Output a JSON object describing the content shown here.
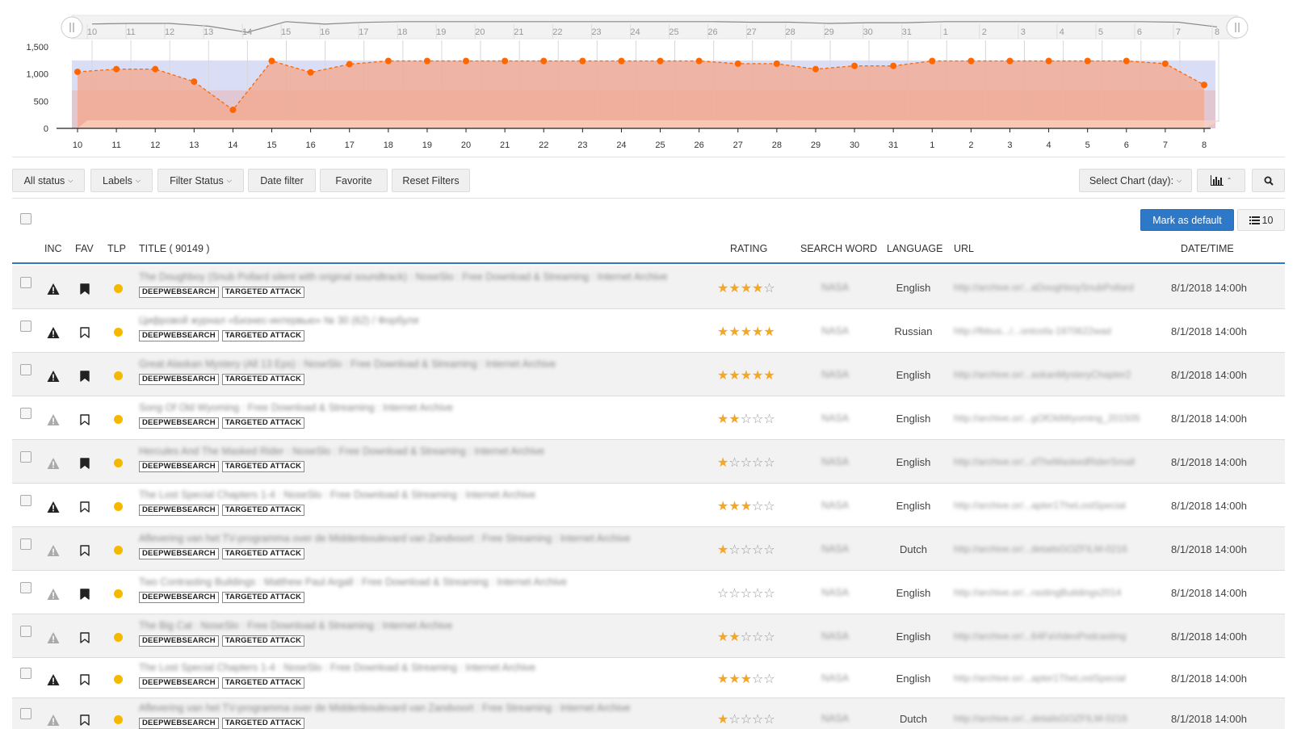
{
  "chart": {
    "navigator_labels": [
      "10",
      "11",
      "12",
      "13",
      "14",
      "15",
      "16",
      "17",
      "18",
      "19",
      "20",
      "21",
      "22",
      "23",
      "24",
      "25",
      "26",
      "27",
      "28",
      "29",
      "30",
      "31",
      "1",
      "2",
      "3",
      "4",
      "5",
      "6",
      "7",
      "8"
    ],
    "x_labels": [
      "10",
      "11",
      "12",
      "13",
      "14",
      "15",
      "16",
      "17",
      "18",
      "19",
      "20",
      "21",
      "22",
      "23",
      "24",
      "25",
      "26",
      "27",
      "28",
      "29",
      "30",
      "31",
      "1",
      "2",
      "3",
      "4",
      "5",
      "6",
      "7",
      "8"
    ],
    "y_ticks": [
      "1,500",
      "1,000",
      "500",
      "0"
    ],
    "series_color": "#ff6600",
    "fill_color": "#f4a58a",
    "band_color": "#d3d7f5"
  },
  "chart_data": {
    "type": "area",
    "x": [
      "10",
      "11",
      "12",
      "13",
      "14",
      "15",
      "16",
      "17",
      "18",
      "19",
      "20",
      "21",
      "22",
      "23",
      "24",
      "25",
      "26",
      "27",
      "28",
      "29",
      "30",
      "31",
      "1",
      "2",
      "3",
      "4",
      "5",
      "6",
      "7",
      "8"
    ],
    "series": [
      {
        "values": [
          1040,
          1090,
          1090,
          860,
          340,
          1240,
          1030,
          1180,
          1240,
          1240,
          1240,
          1240,
          1240,
          1240,
          1240,
          1240,
          1240,
          1190,
          1190,
          1090,
          1150,
          1150,
          1240,
          1240,
          1240,
          1240,
          1240,
          1240,
          1190,
          800
        ]
      }
    ],
    "ylim": [
      0,
      1500
    ],
    "y_ticks": [
      0,
      500,
      1000,
      1500
    ],
    "grid": true,
    "legend": "none"
  },
  "toolbar": {
    "all_status": "All status",
    "labels": "Labels",
    "filter_status": "Filter Status",
    "date_filter": "Date filter",
    "favorite": "Favorite",
    "reset_filters": "Reset Filters",
    "select_chart": "Select Chart (day):"
  },
  "actions": {
    "mark_default": "Mark as default",
    "page_size": "10"
  },
  "table": {
    "headers": {
      "inc": "INC",
      "fav": "FAV",
      "tlp": "TLP",
      "title": "TITLE ( 90149 )",
      "rating": "RATING",
      "search_word": "SEARCH WORD",
      "language": "LANGUAGE",
      "url": "URL",
      "datetime": "DATE/TIME"
    },
    "rows": [
      {
        "title": "The Doughboy (Snub Pollard silent with original soundtrack) : NoseSlo : Free Download & Streaming : Internet Archive",
        "tags": [
          "DEEPWEBSEARCH",
          "TARGETED ATTACK"
        ],
        "inc": "critical",
        "fav": true,
        "rating": 4,
        "search_word": "NASA",
        "language": "English",
        "url": "http://archive.or/...aDoughboySnubPollard",
        "datetime": "8/1/2018 14:00h"
      },
      {
        "title": "Цифровой журнал «Бизнес-интервью» № 30 (62) / Форбуля",
        "tags": [
          "DEEPWEBSEARCH",
          "TARGETED ATTACK"
        ],
        "inc": "critical",
        "fav": false,
        "rating": 5,
        "search_word": "NASA",
        "language": "Russian",
        "url": "http://fbbus.../...ontosfa-1970622wad",
        "datetime": "8/1/2018 14:00h"
      },
      {
        "title": "Great Alaskan Mystery (All 13 Eps) : NoseSlo : Free Download & Streaming : Internet Archive",
        "tags": [
          "DEEPWEBSEARCH",
          "TARGETED ATTACK"
        ],
        "inc": "critical",
        "fav": true,
        "rating": 5,
        "search_word": "NASA",
        "language": "English",
        "url": "http://archive.or/...askanMysteryChapter2",
        "datetime": "8/1/2018 14:00h"
      },
      {
        "title": "Song Of Old Wyoming : Free Download & Streaming : Internet Archive",
        "tags": [
          "DEEPWEBSEARCH",
          "TARGETED ATTACK"
        ],
        "inc": "low",
        "fav": false,
        "rating": 2,
        "search_word": "NASA",
        "language": "English",
        "url": "http://archive.or/...gOfOldWyoming_201505",
        "datetime": "8/1/2018 14:00h"
      },
      {
        "title": "Hercules And The Masked Rider : NoseSlo : Free Download & Streaming : Internet Archive",
        "tags": [
          "DEEPWEBSEARCH",
          "TARGETED ATTACK"
        ],
        "inc": "low",
        "fav": true,
        "rating": 1,
        "search_word": "NASA",
        "language": "English",
        "url": "http://archive.or/...dTheMaskedRiderSmall",
        "datetime": "8/1/2018 14:00h"
      },
      {
        "title": "The Lost Special Chapters 1-4 : NoseSlo : Free Download & Streaming : Internet Archive",
        "tags": [
          "DEEPWEBSEARCH",
          "TARGETED ATTACK"
        ],
        "inc": "critical",
        "fav": false,
        "rating": 3,
        "search_word": "NASA",
        "language": "English",
        "url": "http://archive.or/...apter1TheLostSpecial",
        "datetime": "8/1/2018 14:00h"
      },
      {
        "title": "Aflevering van het TV-programma over de Middenboulevard van Zandvoort : Free Streaming : Internet Archive",
        "tags": [
          "DEEPWEBSEARCH",
          "TARGETED ATTACK"
        ],
        "inc": "low",
        "fav": false,
        "rating": 1,
        "search_word": "NASA",
        "language": "Dutch",
        "url": "http://archive.or/...detailsGOZFILM-0216",
        "datetime": "8/1/2018 14:00h"
      },
      {
        "title": "Two Contrasting Buildings : Matthew Paul Argall : Free Download & Streaming : Internet Archive",
        "tags": [
          "DEEPWEBSEARCH",
          "TARGETED ATTACK"
        ],
        "inc": "low",
        "fav": true,
        "rating": 0,
        "search_word": "NASA",
        "language": "English",
        "url": "http://archive.or/...rastingBuildings2014",
        "datetime": "8/1/2018 14:00h"
      },
      {
        "title": "The Big Cat : NoseSlo : Free Download & Streaming : Internet Archive",
        "tags": [
          "DEEPWEBSEARCH",
          "TARGETED ATTACK"
        ],
        "inc": "low",
        "fav": false,
        "rating": 2,
        "search_word": "NASA",
        "language": "English",
        "url": "http://archive.or/...64FaVideoPodcasting",
        "datetime": "8/1/2018 14:00h"
      },
      {
        "title": "The Lost Special Chapters 1-4 : NoseSlo : Free Download & Streaming : Internet Archive",
        "tags": [
          "DEEPWEBSEARCH",
          "TARGETED ATTACK"
        ],
        "inc": "critical",
        "fav": false,
        "rating": 3,
        "search_word": "NASA",
        "language": "English",
        "url": "http://archive.or/...apter1TheLostSpecial",
        "datetime": "8/1/2018 14:00h"
      },
      {
        "title": "Aflevering van het TV-programma over de Middenboulevard van Zandvoort : Free Streaming : Internet Archive",
        "tags": [
          "DEEPWEBSEARCH",
          "TARGETED ATTACK"
        ],
        "inc": "low",
        "fav": false,
        "rating": 1,
        "search_word": "NASA",
        "language": "Dutch",
        "url": "http://archive.or/...detailsGOZFILM-0216",
        "datetime": "8/1/2018 14:00h"
      }
    ]
  }
}
